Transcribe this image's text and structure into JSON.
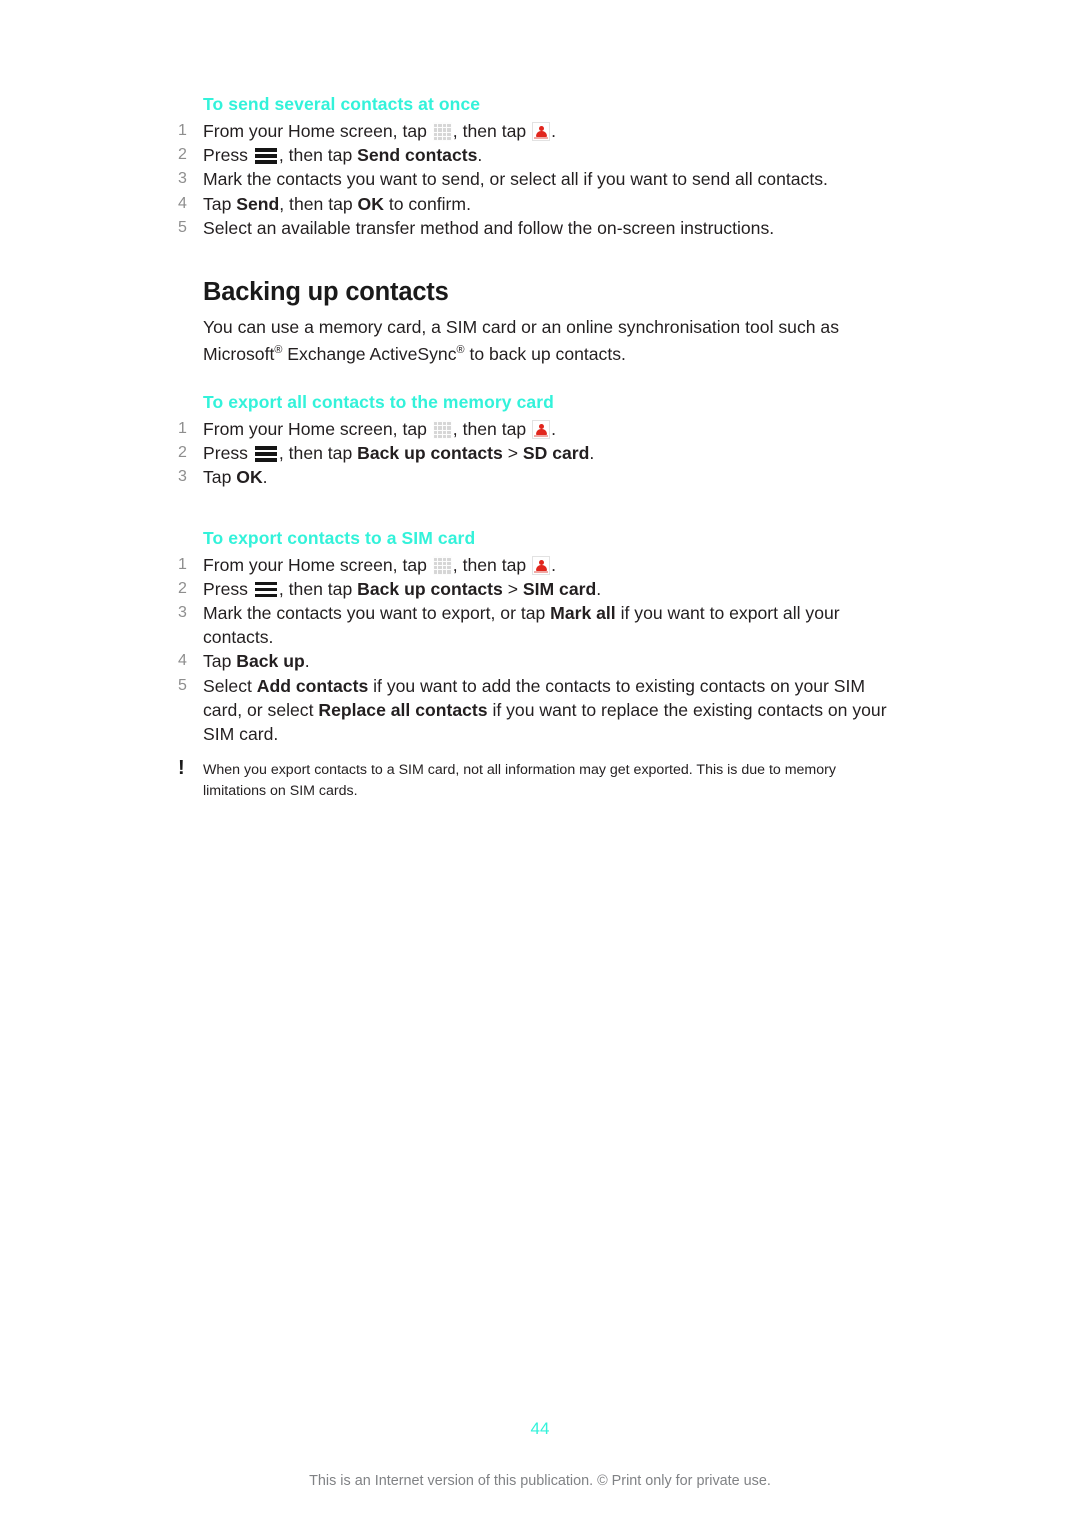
{
  "page": {
    "number": "44",
    "footer_note": "This is an Internet version of this publication. © Print only for private use.",
    "heading_color": "#33f2da",
    "text_color": "#231f20",
    "number_color": "#8e8e8e"
  },
  "section_send": {
    "heading": "To send several contacts at once",
    "steps": {
      "n1": "1",
      "s1_a": "From your Home screen, tap ",
      "s1_b": ", then tap ",
      "s1_c": ".",
      "n2": "2",
      "s2_a": "Press ",
      "s2_b": ", then tap ",
      "s2_bold": "Send contacts",
      "s2_c": ".",
      "n3": "3",
      "s3": "Mark the contacts you want to send, or select all if you want to send all contacts.",
      "n4": "4",
      "s4_a": "Tap ",
      "s4_bold1": "Send",
      "s4_b": ", then tap ",
      "s4_bold2": "OK",
      "s4_c": " to confirm.",
      "n5": "5",
      "s5": "Select an available transfer method and follow the on-screen instructions."
    }
  },
  "chapter": {
    "title": "Backing up contacts",
    "intro_a": "You can use a memory card, a SIM card or an online synchronisation tool such as Microsoft",
    "intro_reg1": "®",
    "intro_b": " Exchange ActiveSync",
    "intro_reg2": "®",
    "intro_c": " to back up contacts."
  },
  "section_memory": {
    "heading": "To export all contacts to the memory card",
    "steps": {
      "n1": "1",
      "s1_a": "From your Home screen, tap ",
      "s1_b": ", then tap ",
      "s1_c": ".",
      "n2": "2",
      "s2_a": "Press ",
      "s2_b": ", then tap ",
      "s2_bold1": "Back up contacts",
      "s2_gt": " > ",
      "s2_bold2": "SD card",
      "s2_c": ".",
      "n3": "3",
      "s3_a": "Tap ",
      "s3_bold": "OK",
      "s3_c": "."
    }
  },
  "section_sim": {
    "heading": "To export contacts to a SIM card",
    "steps": {
      "n1": "1",
      "s1_a": "From your Home screen, tap ",
      "s1_b": ", then tap ",
      "s1_c": ".",
      "n2": "2",
      "s2_a": "Press ",
      "s2_b": ", then tap ",
      "s2_bold1": "Back up contacts",
      "s2_gt": " > ",
      "s2_bold2": "SIM card",
      "s2_c": ".",
      "n3": "3",
      "s3_a": "Mark the contacts you want to export, or tap ",
      "s3_bold": "Mark all",
      "s3_b": " if you want to export all your contacts.",
      "n4": "4",
      "s4_a": "Tap ",
      "s4_bold": "Back up",
      "s4_c": ".",
      "n5": "5",
      "s5_a": "Select ",
      "s5_bold1": "Add contacts",
      "s5_b": " if you want to add the contacts to existing contacts on your SIM card, or select ",
      "s5_bold2": "Replace all contacts",
      "s5_c": " if you want to replace the existing contacts on your SIM card."
    }
  },
  "note": {
    "marker": "!",
    "text": "When you export contacts to a SIM card, not all information may get exported. This is due to memory limitations on SIM cards."
  },
  "icons": {
    "app_grid": "app-grid-icon",
    "contacts": "contacts-icon",
    "menu_key": "menu-key-icon",
    "warning": "warning-exclamation-icon"
  }
}
